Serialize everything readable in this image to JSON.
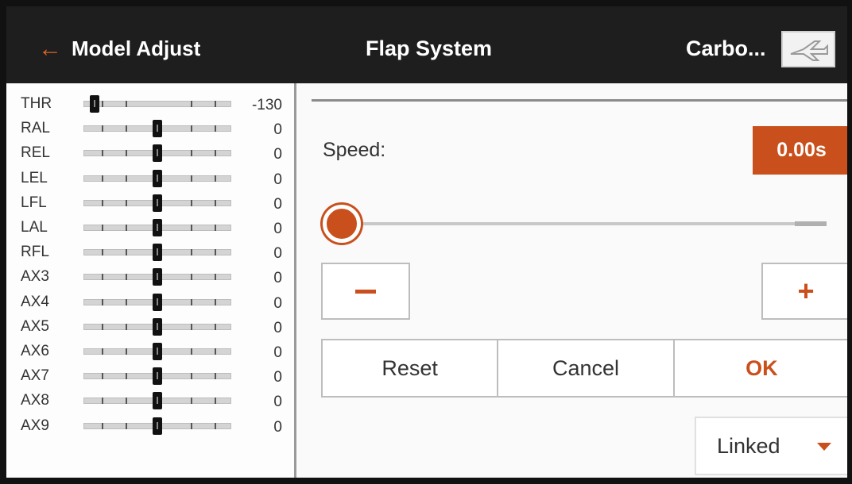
{
  "header": {
    "back_label": "Model Adjust",
    "title": "Flap System",
    "model_name": "Carbo...",
    "model_icon": "airplane-icon"
  },
  "channels": [
    {
      "label": "THR",
      "value": "-130",
      "level": -1.0
    },
    {
      "label": "RAL",
      "value": "0",
      "level": 0
    },
    {
      "label": "REL",
      "value": "0",
      "level": 0
    },
    {
      "label": "LEL",
      "value": "0",
      "level": 0
    },
    {
      "label": "LFL",
      "value": "0",
      "level": 0
    },
    {
      "label": "LAL",
      "value": "0",
      "level": 0
    },
    {
      "label": "RFL",
      "value": "0",
      "level": 0
    },
    {
      "label": "AX3",
      "value": "0",
      "level": 0
    },
    {
      "label": "AX4",
      "value": "0",
      "level": 0
    },
    {
      "label": "AX5",
      "value": "0",
      "level": 0
    },
    {
      "label": "AX6",
      "value": "0",
      "level": 0
    },
    {
      "label": "AX7",
      "value": "0",
      "level": 0
    },
    {
      "label": "AX8",
      "value": "0",
      "level": 0
    },
    {
      "label": "AX9",
      "value": "0",
      "level": 0
    }
  ],
  "speed": {
    "label": "Speed:",
    "value": "0.00s",
    "slider_fraction": 0.0
  },
  "buttons": {
    "minus": "−",
    "plus": "+",
    "reset": "Reset",
    "cancel": "Cancel",
    "ok": "OK"
  },
  "mode_select": {
    "selected": "Linked"
  },
  "colors": {
    "accent": "#c9501c",
    "header_bg": "#1e1e1e"
  }
}
